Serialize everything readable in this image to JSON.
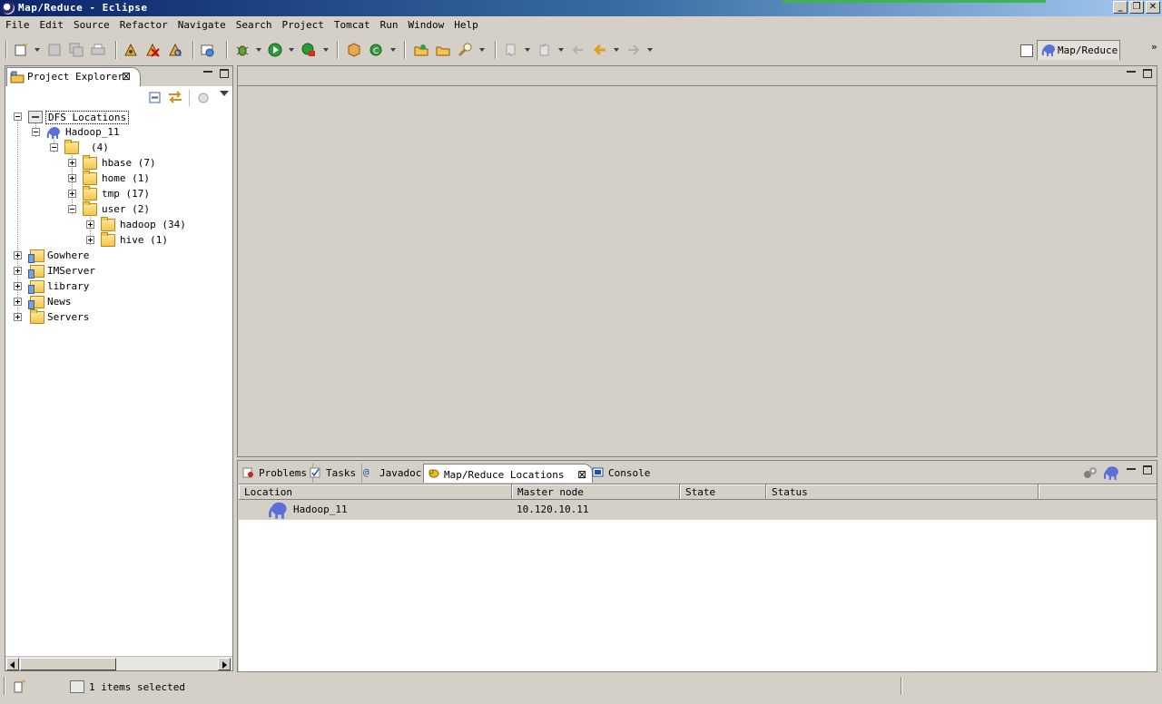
{
  "window": {
    "title": "Map/Reduce - Eclipse"
  },
  "menu": [
    "File",
    "Edit",
    "Source",
    "Refactor",
    "Navigate",
    "Search",
    "Project",
    "Tomcat",
    "Run",
    "Window",
    "Help"
  ],
  "perspective": {
    "label": "Map/Reduce",
    "chevron": "»"
  },
  "project_explorer": {
    "title": "Project Explorer",
    "tree": [
      {
        "label": "DFS Locations",
        "selected": true
      },
      {
        "label": "Hadoop_11"
      },
      {
        "label": "(4)"
      },
      {
        "label": "hbase (7)"
      },
      {
        "label": "home (1)"
      },
      {
        "label": "tmp (17)"
      },
      {
        "label": "user (2)"
      },
      {
        "label": "hadoop (34)"
      },
      {
        "label": "hive (1)"
      },
      {
        "label": "Gowhere"
      },
      {
        "label": "IMServer"
      },
      {
        "label": "library"
      },
      {
        "label": "News"
      },
      {
        "label": "Servers"
      }
    ]
  },
  "bottom_view": {
    "tabs": [
      "Problems",
      "Tasks",
      "Javadoc",
      "Map/Reduce Locations",
      "Console"
    ],
    "active_tab": "Map/Reduce Locations",
    "columns": [
      "Location",
      "Master node",
      "State",
      "Status"
    ],
    "rows": [
      {
        "location": "Hadoop_11",
        "master_node": "10.120.10.11",
        "state": "",
        "status": ""
      }
    ]
  },
  "status_bar": {
    "message": "1 items selected"
  },
  "colors": {
    "title_start": "#0a246a",
    "title_end": "#a6caf0",
    "chrome": "#d4d0c8",
    "elephant": "#5a6fd8"
  }
}
